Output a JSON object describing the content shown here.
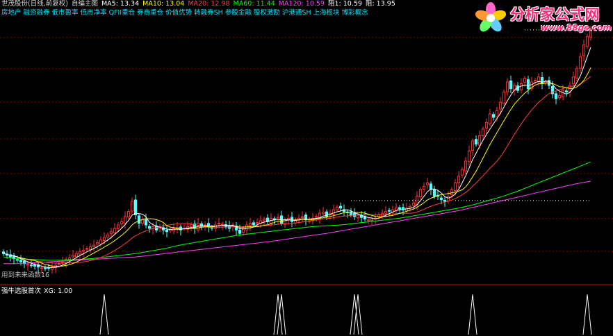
{
  "header": {
    "name": "世茂股份(日线,前复权)",
    "formula": "自编主图",
    "ma5": "MA5: 13.34",
    "ma10": "MA10: 13.04",
    "ma20": "MA20: 12.98",
    "ma60": "MA60: 11.44",
    "ma120": "MA120: 10.59",
    "resist1": "阻1: 10.59",
    "resist2": "阻: 13.95"
  },
  "tags": [
    "房地产",
    "融资融券",
    "低市盈率",
    "低市净率",
    "QFII重仓",
    "券商重仓",
    "价值优势",
    "转融券SH",
    "参股金融",
    "股权激励",
    "沪港通SH",
    "上海板块",
    "博彩概念"
  ],
  "logo": {
    "title": "分析家公式网",
    "url": "www.88gs.com"
  },
  "main_note": "用到未来函数16",
  "sub_header": {
    "name": "强牛选股首次",
    "xg": "XG: 1.00"
  },
  "colors": {
    "up": "#ff3232",
    "down": "#54ffff",
    "ma5": "#ffffff",
    "ma10": "#ffff00",
    "ma20": "#ff4040",
    "ma60": "#00ff00",
    "ma120": "#ff40ff",
    "tags": "#00e5ff",
    "grid": "#8b0000",
    "signal": "#ffffff"
  },
  "chart_data": {
    "type": "line",
    "periods": 170,
    "candles_close": [
      10.8,
      10.7,
      10.6,
      10.5,
      10.4,
      10.3,
      10.2,
      10.15,
      10.1,
      10.05,
      10.0,
      9.95,
      9.9,
      9.95,
      10.0,
      10.1,
      10.2,
      10.3,
      10.45,
      10.55,
      10.7,
      10.8,
      10.9,
      11.0,
      11.1,
      11.2,
      11.3,
      11.45,
      11.6,
      11.75,
      11.9,
      12.1,
      12.3,
      12.5,
      12.7,
      13.0,
      13.3,
      13.9,
      13.1,
      12.6,
      12.8,
      12.5,
      12.3,
      12.4,
      12.2,
      12.4,
      12.2,
      12.1,
      12.25,
      12.3,
      12.35,
      12.2,
      12.3,
      12.4,
      12.5,
      12.3,
      12.6,
      12.4,
      12.5,
      12.4,
      12.3,
      12.5,
      12.6,
      12.55,
      12.4,
      12.3,
      12.5,
      12.2,
      12.0,
      12.3,
      12.5,
      12.6,
      12.5,
      12.65,
      12.75,
      12.85,
      12.7,
      12.9,
      12.8,
      12.95,
      12.6,
      12.8,
      12.9,
      12.7,
      12.8,
      12.9,
      13.0,
      12.8,
      12.75,
      12.9,
      13.0,
      13.2,
      13.25,
      13.0,
      13.2,
      13.4,
      13.55,
      13.5,
      13.3,
      13.25,
      13.1,
      13.0,
      13.1,
      12.95,
      12.85,
      12.8,
      12.85,
      12.9,
      13.1,
      13.2,
      13.3,
      13.35,
      13.4,
      13.5,
      13.45,
      13.4,
      13.5,
      13.6,
      13.8,
      14.2,
      14.6,
      14.8,
      15.0,
      14.6,
      14.2,
      14.2,
      14.0,
      13.9,
      14.2,
      14.6,
      15.0,
      15.4,
      15.8,
      16.3,
      16.9,
      17.5,
      17.3,
      17.8,
      18.2,
      18.6,
      19.1,
      18.9,
      19.3,
      19.8,
      20.4,
      21.0,
      20.6,
      20.8,
      20.5,
      20.9,
      21.2,
      20.6,
      21.0,
      21.1,
      21.3,
      20.9,
      21.0,
      20.8,
      20.3,
      20.0,
      20.2,
      20.5,
      20.4,
      20.8,
      21.3,
      21.8,
      22.5,
      23.2,
      23.7,
      24.1
    ],
    "ma120": [
      10.2,
      10.2,
      10.25,
      10.3,
      10.35,
      10.4,
      10.45,
      10.5,
      10.55,
      10.6,
      10.7,
      10.8,
      10.9,
      11.0,
      11.1,
      11.2,
      11.3,
      11.4,
      11.5,
      11.62,
      11.75,
      11.88,
      12.0,
      12.15,
      12.3,
      12.45,
      12.6,
      12.75,
      12.9,
      13.05,
      13.2,
      13.35,
      13.55,
      13.75,
      13.95,
      14.15,
      14.35,
      14.55,
      14.75,
      14.95,
      15.1
    ],
    "ma60": [
      10.6,
      10.5,
      10.45,
      10.4,
      10.4,
      10.45,
      10.5,
      10.6,
      10.7,
      10.8,
      10.95,
      11.1,
      11.3,
      11.45,
      11.6,
      11.75,
      11.9,
      12.0,
      12.1,
      12.2,
      12.3,
      12.4,
      12.45,
      12.5,
      12.6,
      12.7,
      12.8,
      12.9,
      13.05,
      13.2,
      13.35,
      13.5,
      13.7,
      13.95,
      14.2,
      14.5,
      14.85,
      15.2,
      15.55,
      15.9,
      16.25
    ],
    "signals": [
      29,
      79,
      80,
      101,
      102,
      135,
      168
    ],
    "sub_ylim": [
      0,
      1
    ]
  }
}
